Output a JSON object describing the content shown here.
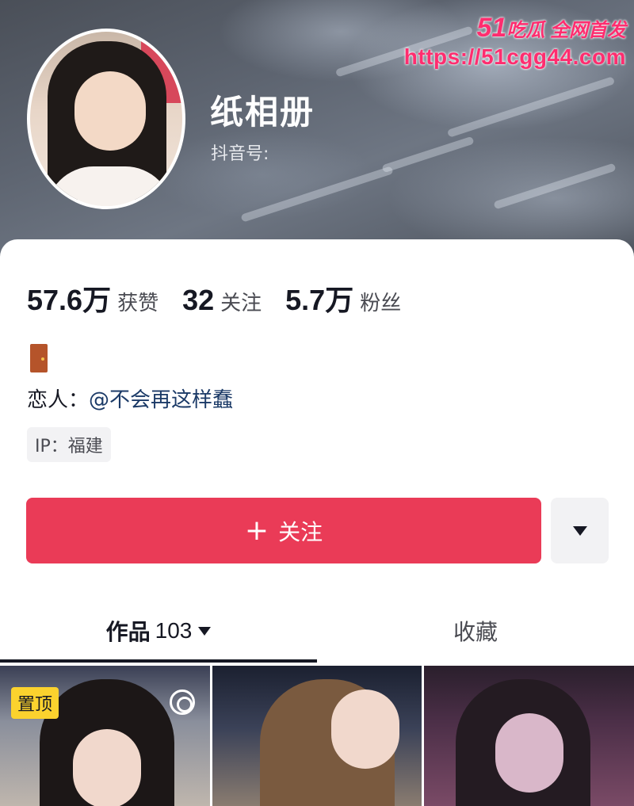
{
  "watermark": {
    "brand_num": "51",
    "brand_text": "吃瓜 全网首发",
    "url": "https://51cgg44.com"
  },
  "profile": {
    "avatar_icon": "avatar",
    "name": "纸相册",
    "douyin_id_label": "抖音号:"
  },
  "stats": [
    {
      "value": "57.6万",
      "label": "获赞"
    },
    {
      "value": "32",
      "label": "关注"
    },
    {
      "value": "5.7万",
      "label": "粉丝"
    }
  ],
  "bio": {
    "emoji_icon": "door-icon",
    "lover_prefix": "恋人：",
    "lover_mention": "@不会再这样蠢"
  },
  "ip_tag": "IP：福建",
  "actions": {
    "follow_plus": "+",
    "follow_label": "关注",
    "more_icon": "triangle-down-icon"
  },
  "tabs": {
    "works_label": "作品",
    "works_count": "103",
    "favorites_label": "收藏"
  },
  "grid": {
    "pin_label": "置顶"
  },
  "colors": {
    "accent": "#ea3b57",
    "watermark": "#ff2d6f",
    "pin_badge": "#fbd22e"
  }
}
